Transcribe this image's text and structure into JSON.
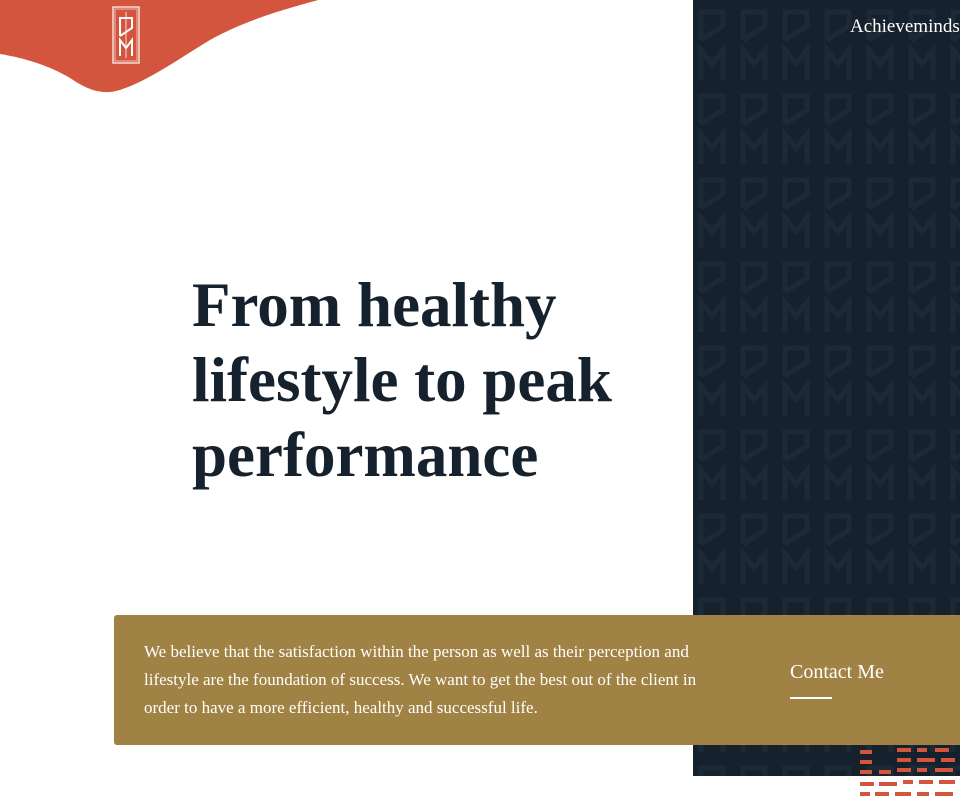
{
  "header": {
    "brand_name": "Achieveminds"
  },
  "hero": {
    "headline_line1": "From healthy",
    "headline_line2": "lifestyle to peak",
    "headline_line3": "performance"
  },
  "banner": {
    "description": "We believe that the satisfaction within the person as well as their perception and lifestyle are the foundation of success. We want to get the best out of the client in order to have a more efficient, healthy and successful life.",
    "contact_label": "Contact Me"
  },
  "icons": {
    "logo": "am-monogram-logo-icon"
  },
  "colors": {
    "accent_orange": "#d4553d",
    "dark_navy": "#15212c",
    "gold": "#a08244",
    "white": "#ffffff"
  }
}
